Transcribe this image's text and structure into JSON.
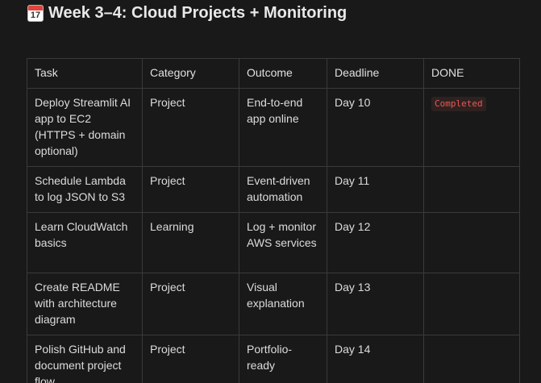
{
  "page": {
    "icon": "calendar-icon",
    "icon_day": "17",
    "icon_month": "JUL",
    "title": "Week 3–4: Cloud Projects + Monitoring"
  },
  "table": {
    "headers": [
      "Task",
      "Category",
      "Outcome",
      "Deadline",
      "DONE"
    ],
    "rows": [
      {
        "task": "Deploy Streamlit AI app to EC2 (HTTPS + domain optional)",
        "category": "Project",
        "outcome": "End-to-end app online",
        "deadline": "Day 10",
        "done": "Completed"
      },
      {
        "task": "Schedule Lambda to log JSON to S3",
        "category": "Project",
        "outcome": "Event-driven automation",
        "deadline": "Day 11",
        "done": ""
      },
      {
        "task": "Learn CloudWatch basics",
        "category": "Learning",
        "outcome": "Log + monitor AWS services",
        "deadline": "Day 12",
        "done": ""
      },
      {
        "task": "Create README with architecture diagram",
        "category": "Project",
        "outcome": "Visual explanation",
        "deadline": "Day 13",
        "done": ""
      },
      {
        "task": "Polish GitHub and document project flow",
        "category": "Project",
        "outcome": "Portfolio-ready",
        "deadline": "Day 14",
        "done": ""
      }
    ]
  },
  "colors": {
    "background": "#191919",
    "border": "#3a3a3a",
    "badge_text": "#eb5757",
    "badge_bg": "#2d2220"
  }
}
